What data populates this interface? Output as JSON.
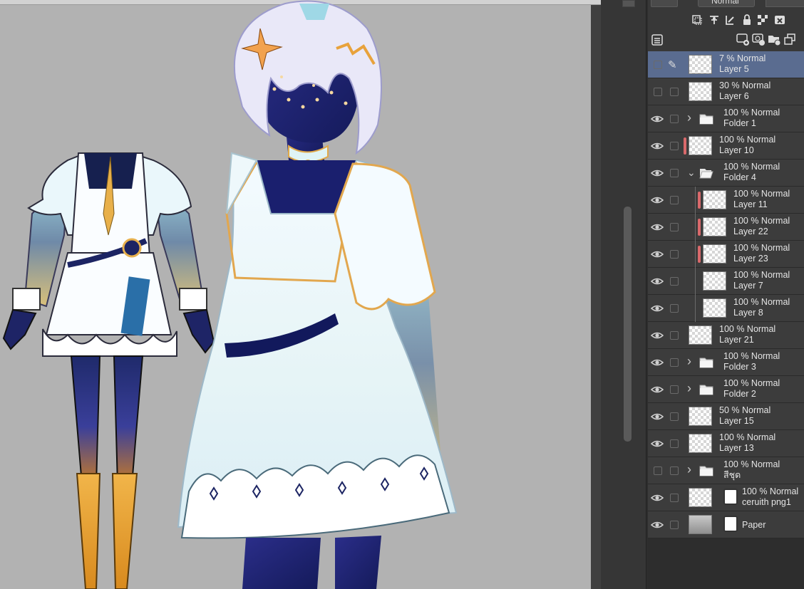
{
  "layer_toolbar": {
    "blend_mode_label": "Normal",
    "icons": [
      "layer-properties-icon",
      "blend-dropdown-icon",
      "clip-to-layer-below-icon",
      "reference-layer-icon",
      "draft-layer-icon",
      "lock-layer-icon",
      "lock-transparency-icon",
      "mask-icon",
      "new-raster-layer-icon",
      "new-vector-layer-icon",
      "new-folder-icon",
      "duplicate-layer-icon",
      "panel-menu-icon"
    ]
  },
  "layers": [
    {
      "opacity_mode": "7 % Normal",
      "name": "Layer 5",
      "kind": "raster",
      "visible": false,
      "selected": true,
      "editing": true,
      "indent": 0,
      "tag": false
    },
    {
      "opacity_mode": "30 % Normal",
      "name": "Layer 6",
      "kind": "raster",
      "visible": false,
      "indent": 0,
      "tag": false
    },
    {
      "opacity_mode": "100 % Normal",
      "name": "Folder 1",
      "kind": "folder",
      "visible": true,
      "expanded": false,
      "indent": 0,
      "tag": false
    },
    {
      "opacity_mode": "100 % Normal",
      "name": "Layer 10",
      "kind": "raster",
      "visible": true,
      "indent": 0,
      "tag": true
    },
    {
      "opacity_mode": "100 % Normal",
      "name": "Folder 4",
      "kind": "folder",
      "visible": true,
      "expanded": true,
      "indent": 0,
      "tag": false
    },
    {
      "opacity_mode": "100 % Normal",
      "name": "Layer 11",
      "kind": "raster",
      "visible": true,
      "indent": 1,
      "tag": true
    },
    {
      "opacity_mode": "100 % Normal",
      "name": "Layer 22",
      "kind": "raster",
      "visible": true,
      "indent": 1,
      "tag": true
    },
    {
      "opacity_mode": "100 % Normal",
      "name": "Layer 23",
      "kind": "raster",
      "visible": true,
      "indent": 1,
      "tag": true
    },
    {
      "opacity_mode": "100 % Normal",
      "name": "Layer 7",
      "kind": "raster",
      "visible": true,
      "indent": 1,
      "tag": false
    },
    {
      "opacity_mode": "100 % Normal",
      "name": "Layer 8",
      "kind": "raster",
      "visible": true,
      "indent": 1,
      "tag": false
    },
    {
      "opacity_mode": "100 % Normal",
      "name": "Layer 21",
      "kind": "raster",
      "visible": true,
      "indent": 0,
      "tag": false
    },
    {
      "opacity_mode": "100 % Normal",
      "name": "Folder 3",
      "kind": "folder",
      "visible": true,
      "expanded": false,
      "indent": 0,
      "tag": false
    },
    {
      "opacity_mode": "100 % Normal",
      "name": "Folder 2",
      "kind": "folder",
      "visible": true,
      "expanded": false,
      "indent": 0,
      "tag": false
    },
    {
      "opacity_mode": "50 % Normal",
      "name": "Layer 15",
      "kind": "raster",
      "visible": true,
      "indent": 0,
      "tag": false
    },
    {
      "opacity_mode": "100 % Normal",
      "name": "Layer 13",
      "kind": "raster",
      "visible": true,
      "indent": 0,
      "tag": false
    },
    {
      "opacity_mode": "100 % Normal",
      "name": "สีชุด",
      "kind": "folder",
      "visible": false,
      "expanded": false,
      "indent": 0,
      "tag": false
    },
    {
      "opacity_mode": "100 % Normal",
      "name": "ceruith png1",
      "kind": "raster-masked",
      "visible": true,
      "indent": 0,
      "tag": false
    },
    {
      "opacity_mode": "",
      "name": "Paper",
      "kind": "paper",
      "visible": true,
      "indent": 0,
      "tag": false
    }
  ],
  "colors": {
    "canvas_bg": "#b2b2b2",
    "panel_bg": "#2d2d2d",
    "row_bg": "#3c3c3c",
    "row_selected": "#5a6c90",
    "color_tag": "#d9696b"
  }
}
